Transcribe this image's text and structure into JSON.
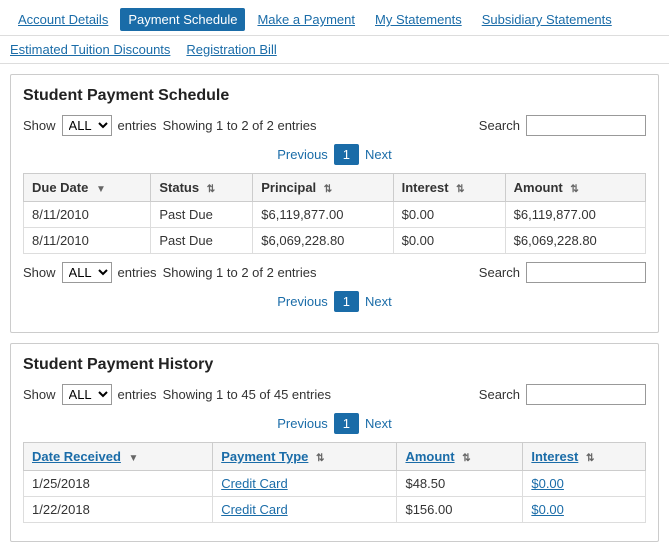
{
  "topNav": {
    "items": [
      {
        "label": "Account Details",
        "active": false
      },
      {
        "label": "Payment Schedule",
        "active": true
      },
      {
        "label": "Make a Payment",
        "active": false
      },
      {
        "label": "My Statements",
        "active": false
      },
      {
        "label": "Subsidiary Statements",
        "active": false
      }
    ]
  },
  "subNav": {
    "items": [
      {
        "label": "Estimated Tuition Discounts"
      },
      {
        "label": "Registration Bill"
      }
    ]
  },
  "paymentSchedule": {
    "title": "Student Payment Schedule",
    "showLabel": "Show",
    "showValue": "ALL",
    "entriesLabel": "entries",
    "showingText": "Showing 1 to 2 of 2 entries",
    "searchLabel": "Search",
    "previousLabel": "Previous",
    "nextLabel": "Next",
    "pageNum": "1",
    "columns": [
      {
        "label": "Due Date",
        "sortable": true,
        "sorted": true,
        "linked": false
      },
      {
        "label": "Status",
        "sortable": true,
        "sorted": false,
        "linked": false
      },
      {
        "label": "Principal",
        "sortable": true,
        "sorted": false,
        "linked": false
      },
      {
        "label": "Interest",
        "sortable": true,
        "sorted": false,
        "linked": false
      },
      {
        "label": "Amount",
        "sortable": true,
        "sorted": false,
        "linked": false
      }
    ],
    "rows": [
      {
        "dueDate": "8/11/2010",
        "status": "Past Due",
        "principal": "$6,119,877.00",
        "interest": "$0.00",
        "amount": "$6,119,877.00"
      },
      {
        "dueDate": "8/11/2010",
        "status": "Past Due",
        "principal": "$6,069,228.80",
        "interest": "$0.00",
        "amount": "$6,069,228.80"
      }
    ],
    "bottomShowingText": "Showing 1 to 2 of 2 entries"
  },
  "paymentHistory": {
    "title": "Student Payment History",
    "showLabel": "Show",
    "showValue": "ALL",
    "entriesLabel": "entries",
    "showingText": "Showing 1 to 45 of 45 entries",
    "searchLabel": "Search",
    "previousLabel": "Previous",
    "nextLabel": "Next",
    "pageNum": "1",
    "columns": [
      {
        "label": "Date Received",
        "sortable": true,
        "sorted": true,
        "linked": true
      },
      {
        "label": "Payment Type",
        "sortable": true,
        "sorted": false,
        "linked": true
      },
      {
        "label": "Amount",
        "sortable": true,
        "sorted": false,
        "linked": true
      },
      {
        "label": "Interest",
        "sortable": true,
        "sorted": false,
        "linked": true
      }
    ],
    "rows": [
      {
        "dateReceived": "1/25/2018",
        "paymentType": "Credit Card",
        "amount": "$48.50",
        "interest": "$0.00"
      },
      {
        "dateReceived": "1/22/2018",
        "paymentType": "Credit Card",
        "amount": "$156.00",
        "interest": "$0.00"
      }
    ]
  }
}
